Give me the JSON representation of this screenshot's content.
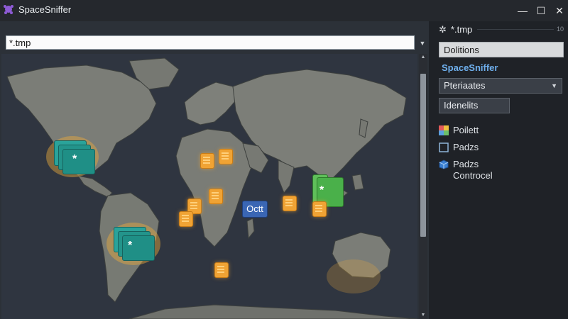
{
  "window": {
    "title": "SpaceSniffer",
    "minimize": "—",
    "maximize": "☐",
    "close": "✕"
  },
  "search": {
    "value": "*.tmp",
    "dropdown": "▼"
  },
  "map": {
    "badge_label": "Octt",
    "folder_star": "*"
  },
  "scrollbar": {
    "up": "▲",
    "down": "▼"
  },
  "panel": {
    "header": "*.tmp",
    "header_icon": "gear-icon",
    "close_glyph": "10",
    "options_button": "Dolitions",
    "app_label": "SpaceSniffer",
    "filter_select": "Pteriaates",
    "filter_caret": "▼",
    "identities_button": "Idenelits",
    "items": [
      {
        "label": "Poilett",
        "icon": "palette-icon"
      },
      {
        "label": "Padzs",
        "icon": "square-icon"
      },
      {
        "label": "Padzs\nControcel",
        "icon": "cube-icon"
      }
    ]
  },
  "colors": {
    "accent_blue": "#6fb0ee",
    "marker_orange": "#f0a334",
    "folder_teal": "#1f8f86",
    "folder_green": "#4ab04a",
    "badge_blue": "#3a66b4"
  }
}
